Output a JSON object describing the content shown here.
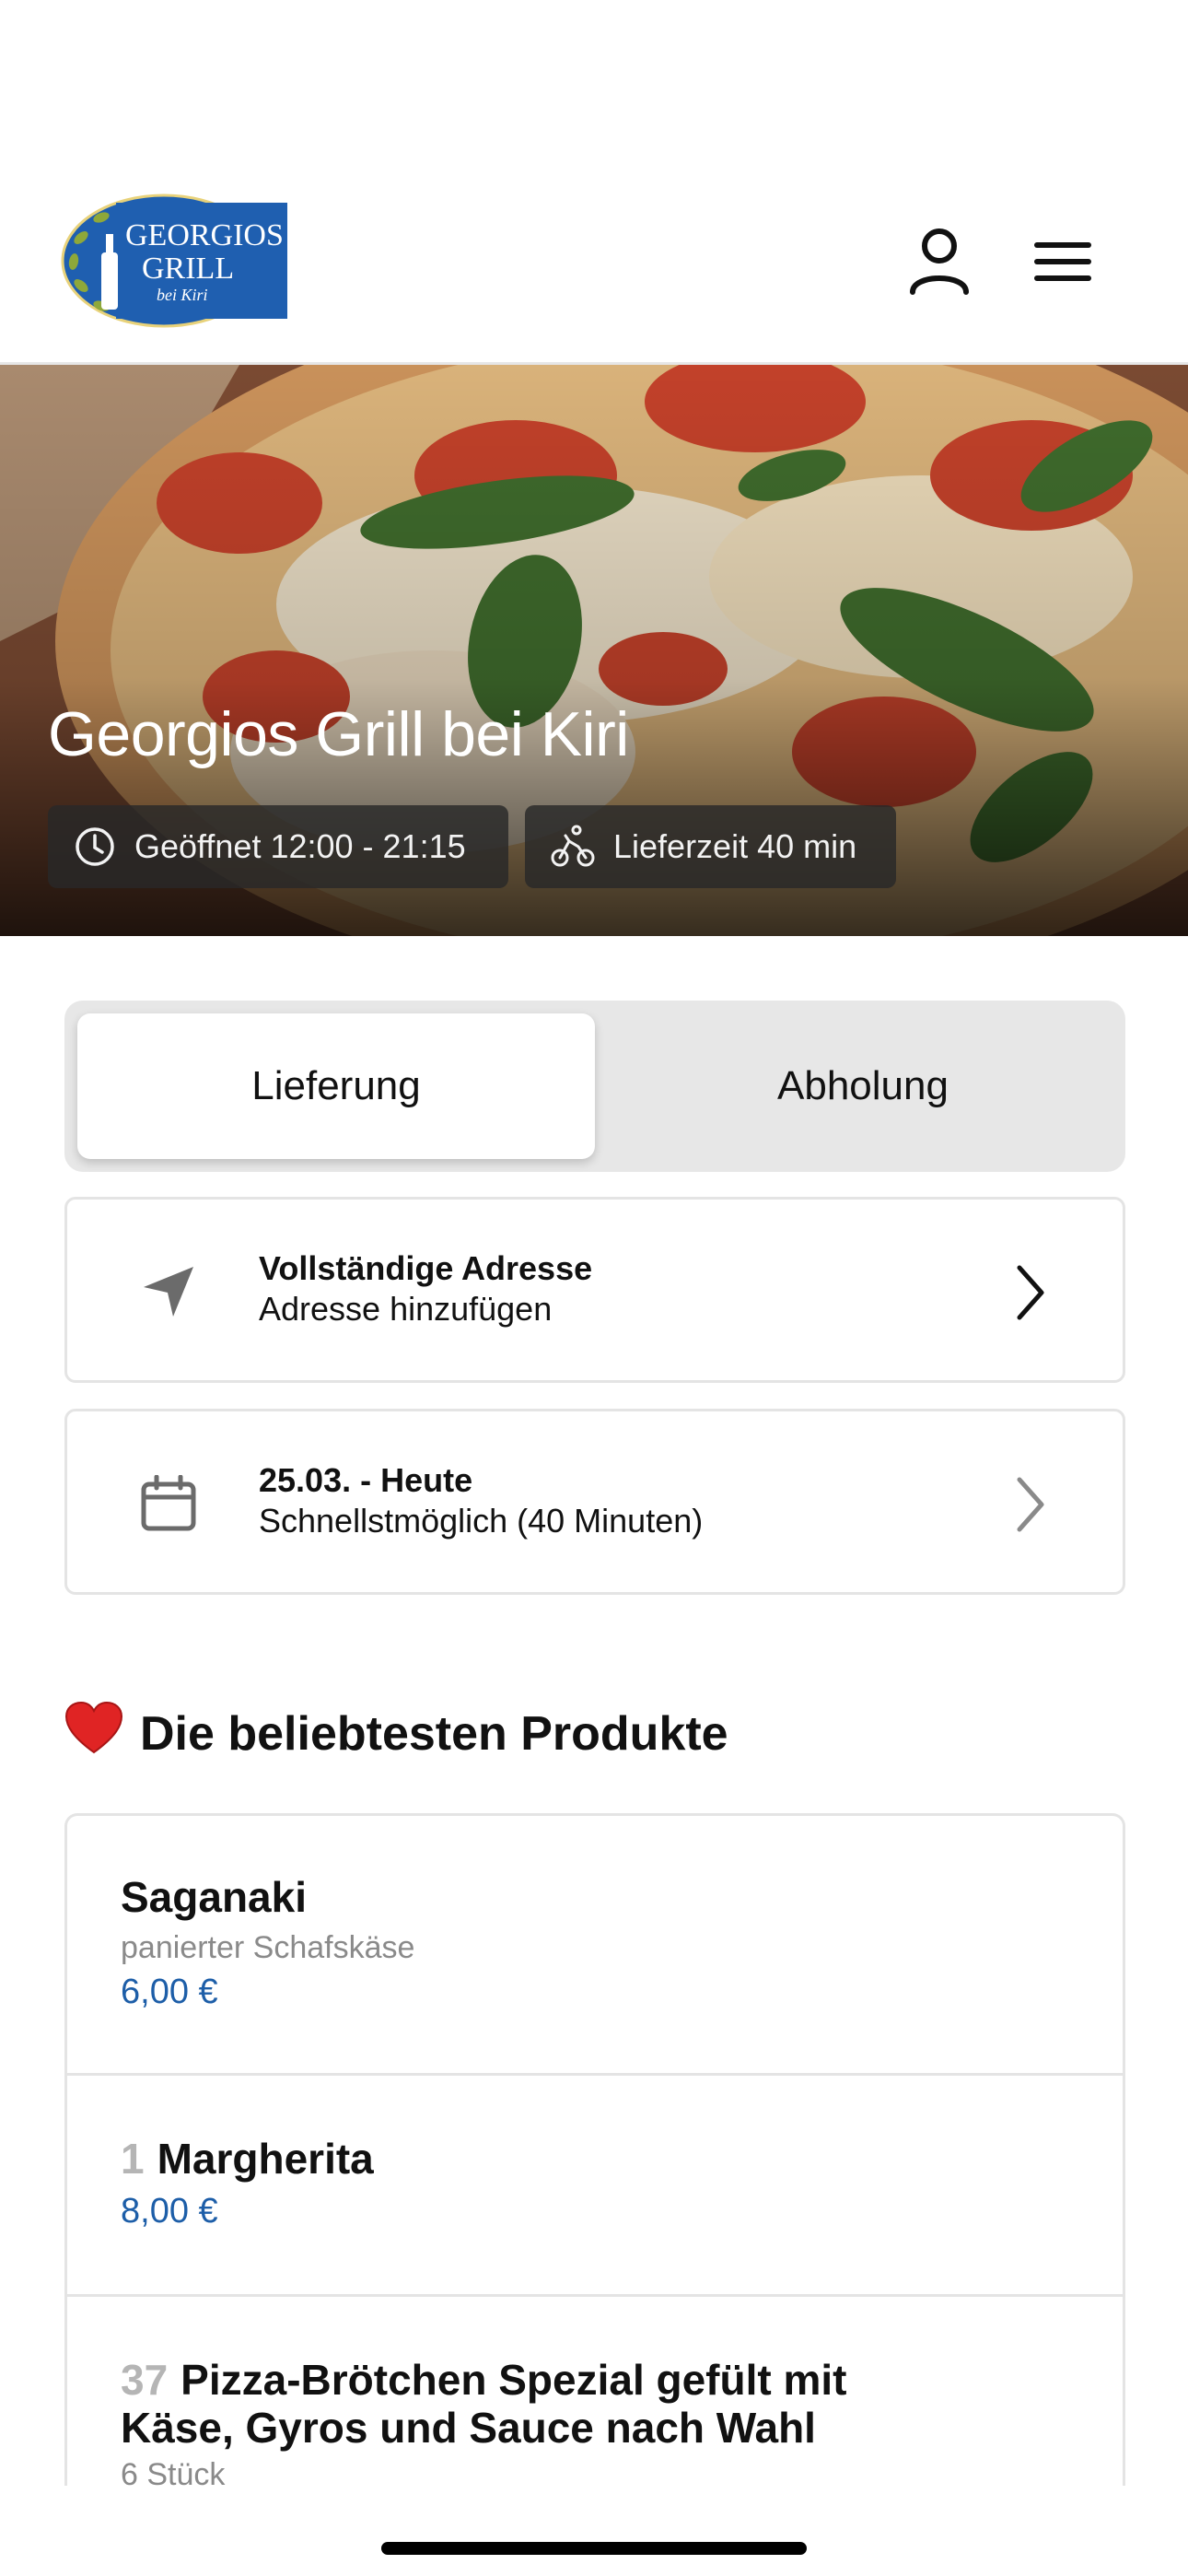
{
  "header": {
    "logo": {
      "line1": "GEORGIOS",
      "line2": "GRILL",
      "line3": "bei Kiri",
      "brand_color": "#1f5fb0"
    },
    "user_icon": "user-icon",
    "menu_icon": "hamburger-menu-icon"
  },
  "hero": {
    "title": "Georgios Grill bei Kiri",
    "opening_hours": "Geöffnet 12:00 - 21:15",
    "delivery_time": "Lieferzeit 40 min"
  },
  "order_mode": {
    "options": [
      "Lieferung",
      "Abholung"
    ],
    "selected": "Lieferung"
  },
  "address_card": {
    "title": "Vollständige Adresse",
    "subtitle": "Adresse hinzufügen",
    "icon": "location-arrow-icon"
  },
  "time_card": {
    "title": "25.03. - Heute",
    "subtitle": "Schnellstmöglich (40 Minuten)",
    "icon": "calendar-icon"
  },
  "popular": {
    "heading": "Die beliebtesten Produkte",
    "heading_emoji": "❤️",
    "products": [
      {
        "number": "",
        "name": "Saganaki",
        "description": "panierter Schafskäse",
        "price": "6,00 €"
      },
      {
        "number": "1",
        "name": "Margherita",
        "description": "",
        "price": "8,00 €"
      },
      {
        "number": "37",
        "name": "Pizza-Brötchen Spezial gefült mit Käse, Gyros und Sauce nach Wahl",
        "description": "6 Stück",
        "price": ""
      }
    ]
  },
  "colors": {
    "accent_price": "#1d5ea8",
    "segment_bg": "#e7e7e7",
    "card_border": "#e4e4e4"
  }
}
